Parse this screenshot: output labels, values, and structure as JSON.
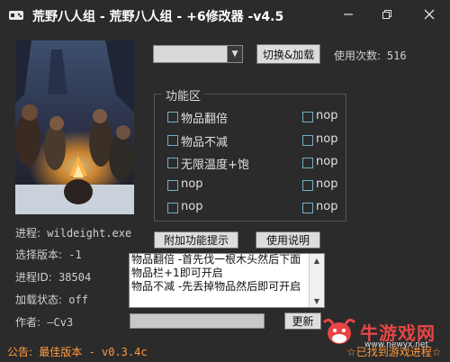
{
  "window": {
    "title": "荒野八人组 - 荒野八人组 - +6修改器 -v4.5"
  },
  "controls": {
    "version_select_value": "",
    "toggle_load_button": "切换&加载",
    "usage_label": "使用次数:",
    "usage_count": "516"
  },
  "features": {
    "group_label": "功能区",
    "left": [
      "物品翻倍",
      "物品不减",
      "无限温度+饱",
      "nop",
      "nop"
    ],
    "right": [
      "nop",
      "nop",
      "nop",
      "nop",
      "nop"
    ]
  },
  "buttons": {
    "extra_hints": "附加功能提示",
    "instructions": "使用说明",
    "update": "更新"
  },
  "info": {
    "process_label": "进程:",
    "process_value": "wildeight.exe",
    "version_label": "选择版本:",
    "version_value": "-1",
    "pid_label": "进程ID:",
    "pid_value": "38504",
    "load_label": "加载状态:",
    "load_value": "off",
    "author_label": "作者:",
    "author_value": "—Cv3"
  },
  "hint_text": "物品翻倍 -首先伐一根木头然后下面物品栏+1即可开启\n物品不减 -先丢掉物品然后即可开启",
  "update_field_value": "",
  "notice": {
    "label": "公告:",
    "title": "最佳版本",
    "version": " - v0.3.4c"
  },
  "found_text": "☆已找到游戏进程☆",
  "watermark": {
    "brand": "牛游戏网",
    "url": "www.newyx.net"
  },
  "colors": {
    "background": "#2b2b2b",
    "accent_orange": "#ff9a3c",
    "checkbox_border": "#6fb0c8",
    "watermark_red": "#e84545"
  }
}
